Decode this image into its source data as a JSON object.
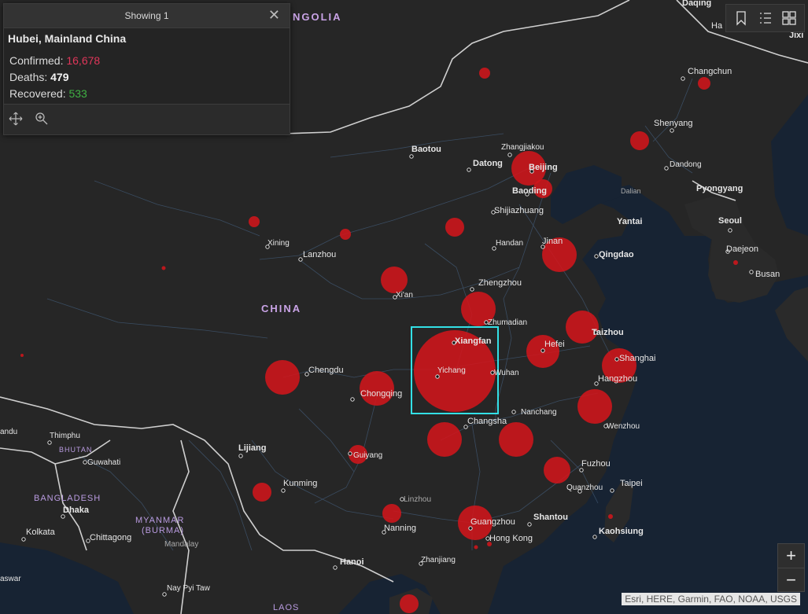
{
  "popup": {
    "header": "Showing 1",
    "title": "Hubei, Mainland China",
    "confirmed_label": "Confirmed:",
    "confirmed_value": "16,678",
    "deaths_label": "Deaths:",
    "deaths_value": "479",
    "recovered_label": "Recovered:",
    "recovered_value": "533"
  },
  "toolbar": {
    "icons": [
      "bookmark-icon",
      "legend-list-icon",
      "basemap-gallery-icon"
    ]
  },
  "zoom": {
    "in": "+",
    "out": "−"
  },
  "attribution": "Esri, HERE, Garmin, FAO, NOAA, USGS",
  "colors": {
    "case_circle": "#d0161b",
    "selection": "#33e0e6",
    "confirmed": "#e0365a",
    "recovered": "#3fb143"
  },
  "labels": {
    "mongolia": "NGOLIA",
    "china": "CHINA",
    "bhutan": "BHUTAN",
    "bangladesh": "BANGLADESH",
    "myanmar1": "MYANMAR",
    "myanmar2": "(BURMA)",
    "laos": "LAOS",
    "daqing": "Daqing",
    "ha": "Ha",
    "jixi": "Jixi",
    "changchun": "Changchun",
    "shenyang": "Shenyang",
    "baotou": "Baotou",
    "zhangjiakou": "Zhangjiakou",
    "datong": "Datong",
    "beijing": "Beijing",
    "baoding": "Baoding",
    "dandong": "Dandong",
    "dalian": "Dalian",
    "pyongyang": "Pyongyang",
    "shijiazhuang": "Shijiazhuang",
    "yantai": "Yantai",
    "xining": "Xining",
    "lanzhou": "Lanzhou",
    "handan": "Handan",
    "jinan": "Jinan",
    "qingdao": "Qingdao",
    "seoul": "Seoul",
    "daejeon": "Daejeon",
    "busan": "Busan",
    "zhengzhou": "Zhengzhou",
    "xian": "Xi'an",
    "zhumadian": "Zhumadian",
    "taizhou": "Taizhou",
    "xiangfan": "Xiangfan",
    "hefei": "Hefei",
    "shanghai": "Shanghai",
    "chengdu": "Chengdu",
    "yichang": "Yichang",
    "wuhan": "Wuhan",
    "hangzhou": "Hangzhou",
    "chongqing": "Chongqing",
    "nanchang": "Nanchang",
    "wenzhou": "Wenzhou",
    "changsha": "Changsha",
    "thimphu": "Thimphu",
    "lijiang": "Lijiang",
    "guiyang": "Guiyang",
    "guwahati": "Guwahati",
    "fuzhou": "Fuzhou",
    "kunming": "Kunming",
    "quanzhou": "Quanzhou",
    "taipei": "Taipei",
    "linzhou": "Linzhou",
    "dhaka": "Dhaka",
    "nanning": "Nanning",
    "guangzhou": "Guangzhou",
    "shantou": "Shantou",
    "hongkong": "Hong Kong",
    "kaohsiung": "Kaohsiung",
    "kolkata": "Kolkata",
    "chittagong": "Chittagong",
    "mandalay": "Mandalay",
    "zhanjiang": "Zhanjiang",
    "hanoi": "Hanoi",
    "naypyitaw": "Nay Pyi Taw",
    "andu": "andu",
    "aswar": "aswar"
  }
}
